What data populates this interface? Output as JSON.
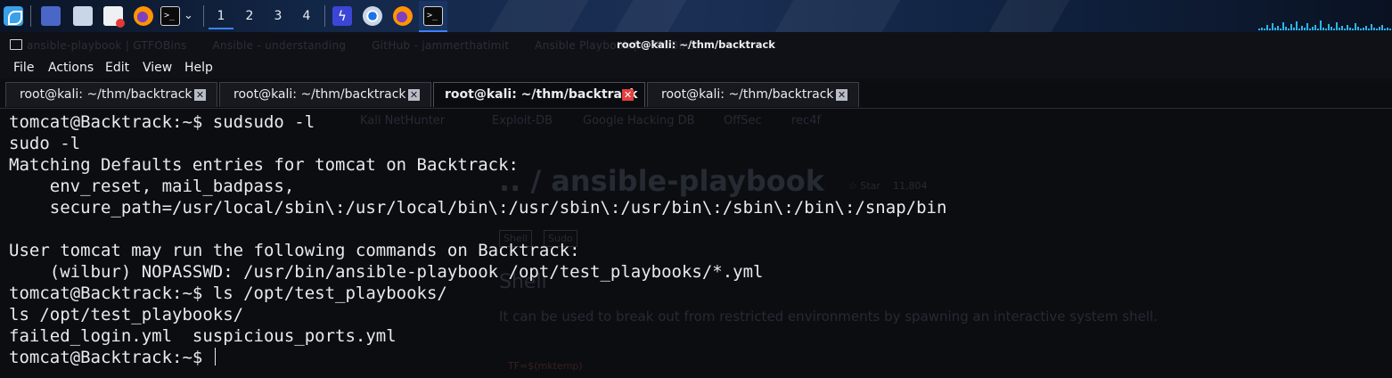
{
  "taskbar": {
    "workspaces": [
      "1",
      "2",
      "3",
      "4"
    ],
    "active_workspace": "1",
    "launchers": [
      "kali-menu-icon",
      "window-icon",
      "file-manager-icon",
      "text-editor-icon",
      "firefox-icon",
      "terminal-icon",
      "bolt-icon",
      "chromium-icon",
      "firefox-icon",
      "terminal-icon"
    ],
    "accent": "#3b82f6"
  },
  "window": {
    "title": "root@kali: ~/thm/backtrack"
  },
  "menu": {
    "file": "File",
    "actions": "Actions",
    "edit": "Edit",
    "view": "View",
    "help": "Help"
  },
  "tabs": [
    {
      "label": "root@kali: ~/thm/backtrack",
      "active": false
    },
    {
      "label": "root@kali: ~/thm/backtrack",
      "active": false
    },
    {
      "label": "root@kali: ~/thm/backtrack",
      "active": true
    },
    {
      "label": "root@kali: ~/thm/backtrack",
      "active": false
    }
  ],
  "terminal": {
    "lines": [
      "tomcat@Backtrack:~$ sudsudo -l",
      "sudo -l",
      "Matching Defaults entries for tomcat on Backtrack:",
      "    env_reset, mail_badpass,",
      "    secure_path=/usr/local/sbin\\:/usr/local/bin\\:/usr/sbin\\:/usr/bin\\:/sbin\\:/bin\\:/snap/bin",
      "",
      "User tomcat may run the following commands on Backtrack:",
      "    (wilbur) NOPASSWD: /usr/bin/ansible-playbook /opt/test_playbooks/*.yml",
      "tomcat@Backtrack:~$ ls /opt/test_playbooks/",
      "ls /opt/test_playbooks/",
      "failed_login.yml  suspicious_ports.yml"
    ],
    "prompt": "tomcat@Backtrack:~$ "
  },
  "background_page": {
    "heading": ".. / ansible-playbook",
    "star": "☆ Star",
    "star_count": "11,804",
    "tags": [
      "Shell",
      "Sudo"
    ],
    "section": "Shell",
    "description": "It can be used to break out from restricted environments by spawning an interactive system shell.",
    "code": "TF=$(mktemp)",
    "bookmarks": [
      "Kali NetHunter",
      "Exploit-DB",
      "Google Hacking DB",
      "OffSec",
      "rec4f"
    ],
    "tabs": [
      "ansible-playbook | GTFOBins",
      "Ansible - understanding",
      "GitHub - jammerthatimit",
      "Ansible Playbook | GTFOBins"
    ]
  }
}
